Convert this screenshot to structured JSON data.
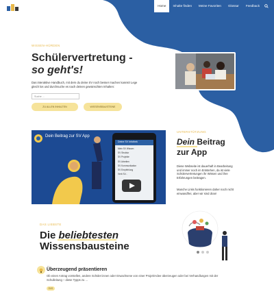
{
  "nav": {
    "items": [
      {
        "label": "Home",
        "active": true
      },
      {
        "label": "Inhalte finden",
        "active": false
      },
      {
        "label": "Meine Favoriten",
        "active": false
      },
      {
        "label": "Glossar",
        "active": false
      },
      {
        "label": "Feedback",
        "active": false
      }
    ],
    "search_icon": "search-icon"
  },
  "hero": {
    "eyebrow": "Wissen-Hürden",
    "title_line1": "Schülervertretung -",
    "title_line2": "so geht's!",
    "lead_line1": "Das interaktive Handbuch, mit dem du deine SV noch besser machen kannst! Lege",
    "lead_line2": "gleich los und durchsuche es nach deinen gewünschten Inhalten:",
    "search_placeholder": "Suche ...",
    "button_primary": "Zu allen Inhalten",
    "button_secondary": "Wissensbausteine"
  },
  "video": {
    "title": "Dein Beitrag zur SV App",
    "phone_header": "Deine SV Infothek",
    "phone_items": [
      "Mein SV Wissen",
      "SV Struktur",
      "SV Projekte",
      "SV Arbeiten",
      "SV Kommunikation",
      "SV Empfehlung",
      "Verb SV..."
    ]
  },
  "app_section": {
    "eyebrow": "Unterstützung",
    "title_em": "Dein",
    "title_rest": " Beitrag",
    "title_line2": "zur App",
    "para1_line1": "Diese Webseite ist dauerhaft in Bearbeitung",
    "para1_line2": "und immer noch im Entstehen, da ist viele",
    "para1_line3": "Schülervertretungen ihr Wissen und ihre",
    "para1_line4": "Erfahrungen beitragen.",
    "para2_line1": "Manche Links funktionieren daher noch nicht",
    "para2_line2": "einwandfrei, aber wir sind dran!"
  },
  "knowledge": {
    "eyebrow": "Das Liebste",
    "title_line1_pre": "Die ",
    "title_line1_em": "beliebtesten",
    "title_line2": "Wissensbausteine",
    "card": {
      "title": "Überzeugend präsentieren",
      "text_line1": "Ob einen Antrag vorstellen, andere Schüler:innen oder Erwachsene von einer Projekt-Idee überzeugen oder bei Verhandlungen mit der",
      "text_line2": "Schulleitung – diese Typps zu ...",
      "tag": "SVG"
    }
  },
  "colors": {
    "blue": "#2b5fa3",
    "yellow": "#f6e39a",
    "accent": "#e8b84a"
  }
}
